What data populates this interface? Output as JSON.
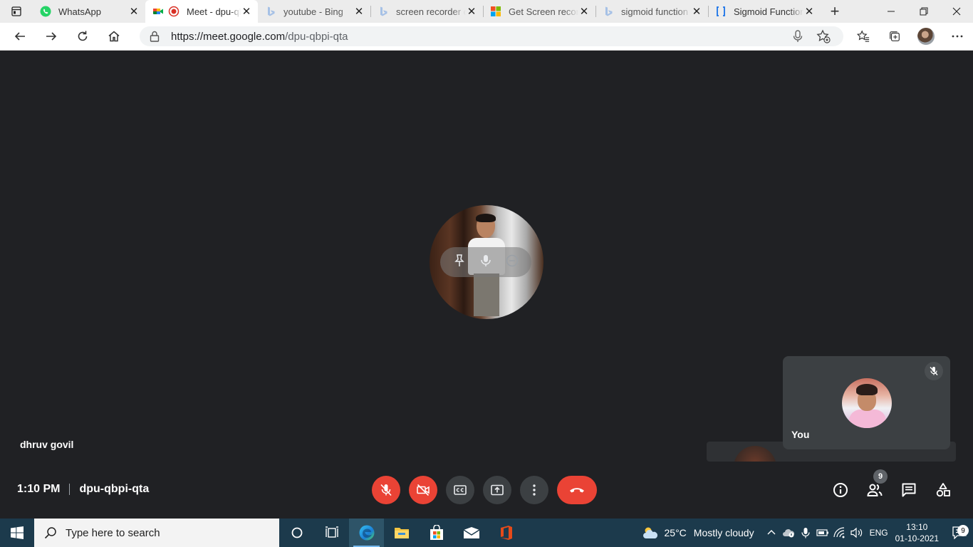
{
  "browser": {
    "tabs": [
      {
        "title": "WhatsApp",
        "icon": "whatsapp-icon",
        "active": false
      },
      {
        "title": "Meet - dpu-qbpi-qta",
        "icon": "google-meet-icon",
        "active": true
      },
      {
        "title": "youtube - Bing",
        "icon": "bing-icon",
        "active": false
      },
      {
        "title": "screen recorder online",
        "icon": "bing-icon",
        "active": false
      },
      {
        "title": "Get Screen recorder",
        "icon": "microsoft-store-icon",
        "active": false
      },
      {
        "title": "sigmoid function",
        "icon": "bing-icon",
        "active": false
      },
      {
        "title": "Sigmoid Function",
        "icon": "bracket-icon",
        "active": false
      }
    ],
    "url_host": "https://meet.google.com",
    "url_path": "/dpu-qbpi-qta"
  },
  "meet": {
    "speaker_name": "dhruv govil",
    "self_label": "You",
    "time": "1:10 PM",
    "meeting_code": "dpu-qbpi-qta",
    "participant_count": "9"
  },
  "taskbar": {
    "search_placeholder": "Type here to search",
    "temperature": "25°C",
    "weather": "Mostly cloudy",
    "language": "ENG",
    "time": "13:10",
    "date": "01-10-2021",
    "notification_count": "9"
  },
  "colors": {
    "meet_background": "#202124",
    "danger": "#ea4335",
    "tile": "#3c4043",
    "taskbar": "#1c3a4c"
  }
}
